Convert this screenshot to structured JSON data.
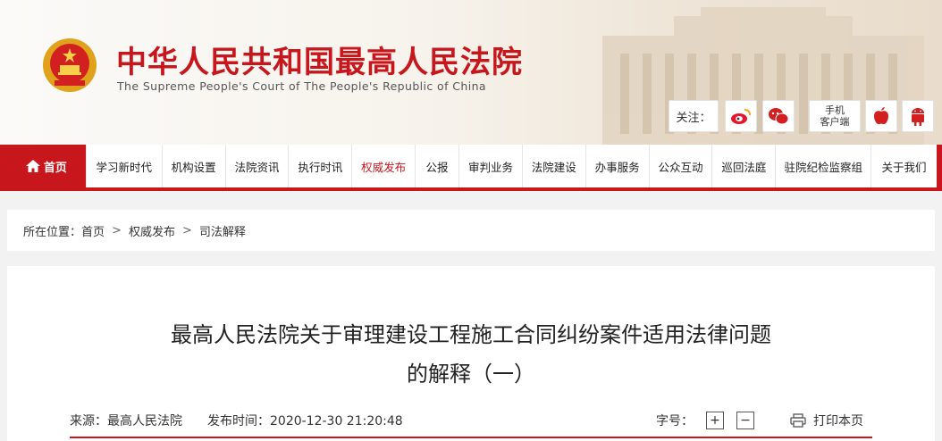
{
  "header": {
    "title_cn": "中华人民共和国最高人民法院",
    "title_en": "The Supreme People's Court of The People's Republic of China",
    "follow_label": "关注：",
    "mobile_label_1": "手机",
    "mobile_label_2": "客户端",
    "icons": [
      "national-emblem-icon",
      "weibo-icon",
      "wechat-icon",
      "apple-icon",
      "android-icon"
    ]
  },
  "nav": {
    "home": "首页",
    "items": [
      "学习新时代",
      "机构设置",
      "法院资讯",
      "执行时讯",
      "权威发布",
      "公报",
      "审判业务",
      "法院建设",
      "办事服务",
      "公众互动",
      "巡回法庭",
      "驻院纪检监察组",
      "关于我们"
    ],
    "active_index": 4
  },
  "breadcrumb": {
    "prefix": "所在位置：",
    "items": [
      "首页",
      "权威发布",
      "司法解释"
    ],
    "separator": ">"
  },
  "article": {
    "title_line1": "最高人民法院关于审理建设工程施工合同纠纷案件适用法律问题",
    "title_line2": "的解释（一）",
    "source": "来源：最高人民法院",
    "publish_time": "发布时间：2020-12-30 21:20:48",
    "font_size_label": "字号：",
    "zoom_in": "+",
    "zoom_out": "−",
    "print_label": "打印本页"
  },
  "colors": {
    "brand_red": "#c8161d",
    "background": "#f2f2f2"
  }
}
